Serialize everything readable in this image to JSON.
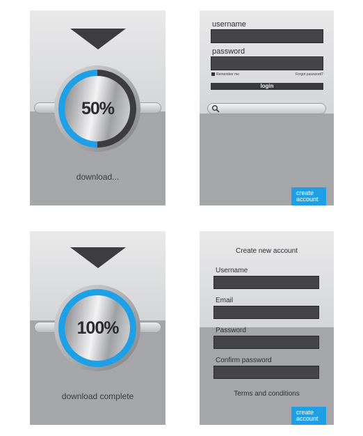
{
  "download_panel": {
    "percent_text": "50%",
    "progress": 0.5,
    "status": "download..."
  },
  "complete_panel": {
    "percent_text": "100%",
    "progress": 1.0,
    "status": "download complete"
  },
  "login_panel": {
    "username_label": "username",
    "password_label": "password",
    "remember_me": "Remember me",
    "forgot_password": "Forgot password?",
    "login_button": "login",
    "create_button_line1": "create",
    "create_button_line2": "account"
  },
  "register_panel": {
    "title": "Create new account",
    "username_label": "Username",
    "email_label": "Email",
    "password_label": "Password",
    "confirm_label": "Confirm password",
    "terms": "Terms and conditions",
    "create_button_line1": "create",
    "create_button_line2": "account"
  },
  "colors": {
    "accent": "#1ea0e6",
    "field": "#444446"
  },
  "icons": [
    "down-arrow-icon",
    "search-icon"
  ]
}
